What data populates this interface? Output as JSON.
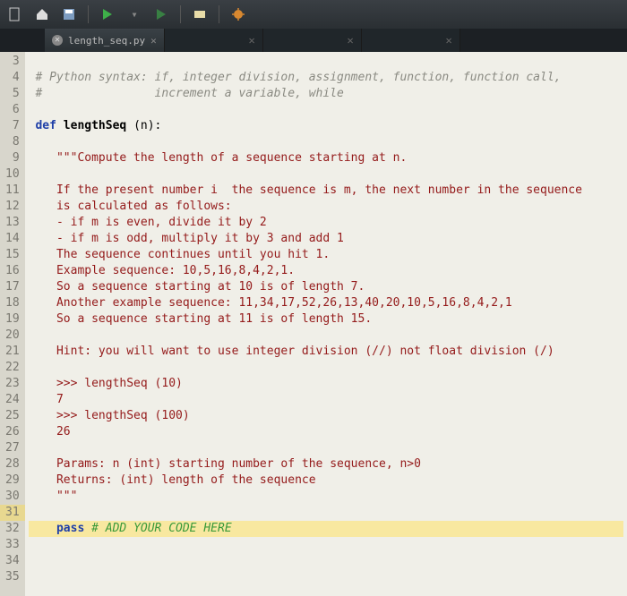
{
  "toolbar": {
    "icons": [
      "home-icon",
      "save-icon",
      "save-as-icon",
      "separator",
      "run-icon",
      "run-all-icon",
      "separator",
      "python-icon",
      "separator",
      "debug-icon"
    ]
  },
  "tabs": {
    "main_label": "length_seq.py"
  },
  "gutter": {
    "start": 3,
    "end": 35
  },
  "code": {
    "l3a": " ",
    "l3b": "# Python syntax: if, integer division, assignment, function, function call,",
    "l4a": " ",
    "l4b": "#                increment a variable, while",
    "l5": " ",
    "l6_def": "def",
    "l6_func": " lengthSeq ",
    "l6_rest": "(n):",
    "l7": "",
    "l8": "    \"\"\"Compute the length of a sequence starting at n.",
    "l9": "",
    "l10": "    If the present number i  the sequence is m, the next number in the sequence",
    "l11": "    is calculated as follows:",
    "l12": "    - if m is even, divide it by 2",
    "l13": "    - if m is odd, multiply it by 3 and add 1",
    "l14": "    The sequence continues until you hit 1.",
    "l15": "    Example sequence: 10,5,16,8,4,2,1.",
    "l16": "    So a sequence starting at 10 is of length 7.",
    "l17": "    Another example sequence: 11,34,17,52,26,13,40,20,10,5,16,8,4,2,1",
    "l18": "    So a sequence starting at 11 is of length 15.",
    "l19": "",
    "l20": "    Hint: you will want to use integer division (//) not float division (/)",
    "l21": "",
    "l22": "    >>> lengthSeq (10)",
    "l23": "    7",
    "l24": "    >>> lengthSeq (100)",
    "l25": "    26",
    "l26": "",
    "l27": "    Params: n (int) starting number of the sequence, n>0",
    "l28": "    Returns: (int) length of the sequence",
    "l29": "    \"\"\"",
    "l30": "",
    "l31_pass": "    pass ",
    "l31_comment": "# ADD YOUR CODE HERE",
    "l32": "",
    "l33": "",
    "l34": "",
    "l35": ""
  }
}
